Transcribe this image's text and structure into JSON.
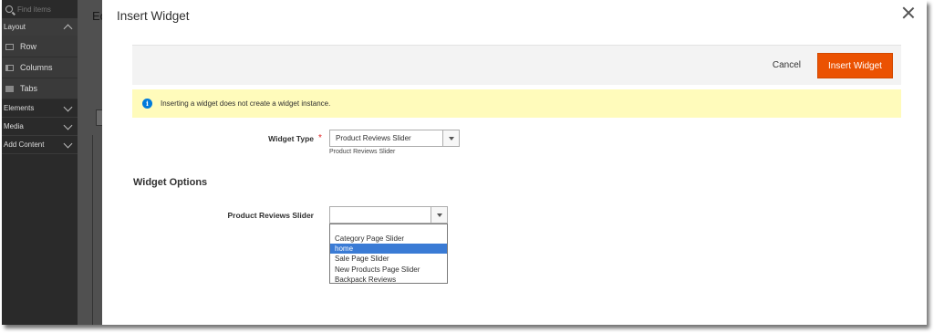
{
  "left_panel": {
    "search_placeholder": "Find items",
    "sections": [
      {
        "label": "Layout",
        "expanded": true,
        "items": [
          {
            "label": "Row",
            "icon": "row-icon"
          },
          {
            "label": "Columns",
            "icon": "columns-icon"
          },
          {
            "label": "Tabs",
            "icon": "tabs-icon"
          }
        ]
      },
      {
        "label": "Elements",
        "expanded": false
      },
      {
        "label": "Media",
        "expanded": false
      },
      {
        "label": "Add Content",
        "expanded": false
      }
    ]
  },
  "background_page": {
    "title_fragment": "Ec"
  },
  "modal": {
    "title": "Insert Widget",
    "close_icon": "close-icon",
    "actions": {
      "cancel_label": "Cancel",
      "insert_label": "Insert Widget"
    },
    "notice": {
      "icon": "info-icon",
      "text": "Inserting a widget does not create a widget instance."
    },
    "widget_type": {
      "label": "Widget Type",
      "required_mark": "*",
      "selected": "Product Reviews Slider",
      "note": "Product Reviews Slider"
    },
    "widget_options": {
      "title": "Widget Options",
      "slider_label": "Product Reviews Slider",
      "slider_value": "",
      "options": [
        {
          "label": "Category Page Slider",
          "highlighted": false
        },
        {
          "label": "home",
          "highlighted": true
        },
        {
          "label": "Sale Page Slider",
          "highlighted": false
        },
        {
          "label": "New Products Page Slider",
          "highlighted": false
        },
        {
          "label": "Backpack Reviews",
          "highlighted": false
        }
      ]
    }
  },
  "colors": {
    "accent": "#eb5202",
    "notice_bg": "#fffbbb",
    "info_icon": "#007bdb",
    "highlight": "#3a7bd5",
    "required": "#e22626"
  }
}
